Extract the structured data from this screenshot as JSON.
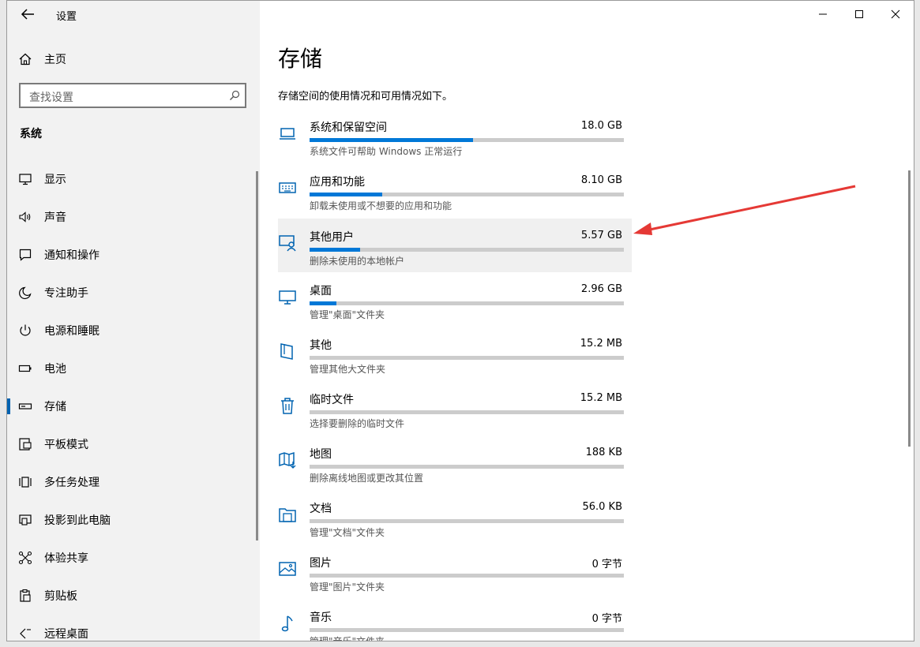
{
  "window": {
    "app_title": "设置"
  },
  "sidebar": {
    "home_label": "主页",
    "search_placeholder": "查找设置",
    "section_title": "系统",
    "items": [
      {
        "label": "显示",
        "icon": "monitor-icon"
      },
      {
        "label": "声音",
        "icon": "speaker-icon"
      },
      {
        "label": "通知和操作",
        "icon": "notification-icon"
      },
      {
        "label": "专注助手",
        "icon": "moon-icon"
      },
      {
        "label": "电源和睡眠",
        "icon": "power-icon"
      },
      {
        "label": "电池",
        "icon": "battery-icon"
      },
      {
        "label": "存储",
        "icon": "storage-drive-icon",
        "selected": true
      },
      {
        "label": "平板模式",
        "icon": "tablet-icon"
      },
      {
        "label": "多任务处理",
        "icon": "multitask-icon"
      },
      {
        "label": "投影到此电脑",
        "icon": "project-icon"
      },
      {
        "label": "体验共享",
        "icon": "share-icon"
      },
      {
        "label": "剪贴板",
        "icon": "clipboard-icon"
      },
      {
        "label": "远程桌面",
        "icon": "remote-desktop-icon"
      }
    ]
  },
  "main": {
    "title": "存储",
    "description": "存储空间的使用情况和可用情况如下。",
    "categories": [
      {
        "name": "系统和保留空间",
        "size": "18.0 GB",
        "sub": "系统文件可帮助 Windows 正常运行",
        "usage_percent": 52,
        "icon": "laptop-icon"
      },
      {
        "name": "应用和功能",
        "size": "8.10 GB",
        "sub": "卸载未使用或不想要的应用和功能",
        "usage_percent": 23,
        "icon": "keyboard-icon"
      },
      {
        "name": "其他用户",
        "size": "5.57 GB",
        "sub": "删除未使用的本地帐户",
        "usage_percent": 16,
        "icon": "user-account-icon",
        "highlighted": true
      },
      {
        "name": "桌面",
        "size": "2.96 GB",
        "sub": "管理\"桌面\"文件夹",
        "usage_percent": 8.5,
        "icon": "desktop-icon"
      },
      {
        "name": "其他",
        "size": "15.2 MB",
        "sub": "管理其他大文件夹",
        "usage_percent": 0,
        "icon": "document-icon"
      },
      {
        "name": "临时文件",
        "size": "15.2 MB",
        "sub": "选择要删除的临时文件",
        "usage_percent": 0,
        "icon": "trash-icon"
      },
      {
        "name": "地图",
        "size": "188 KB",
        "sub": "删除离线地图或更改其位置",
        "usage_percent": 0,
        "icon": "map-icon"
      },
      {
        "name": "文档",
        "size": "56.0 KB",
        "sub": "管理\"文档\"文件夹",
        "usage_percent": 0,
        "icon": "folder-icon"
      },
      {
        "name": "图片",
        "size": "0 字节",
        "sub": "管理\"图片\"文件夹",
        "usage_percent": 0,
        "icon": "picture-icon"
      },
      {
        "name": "音乐",
        "size": "0 字节",
        "sub": "管理\"音乐\"文件夹",
        "usage_percent": 0,
        "icon": "music-icon"
      }
    ]
  },
  "colors": {
    "accent": "#0078d7",
    "annotation_arrow": "#e53935"
  }
}
